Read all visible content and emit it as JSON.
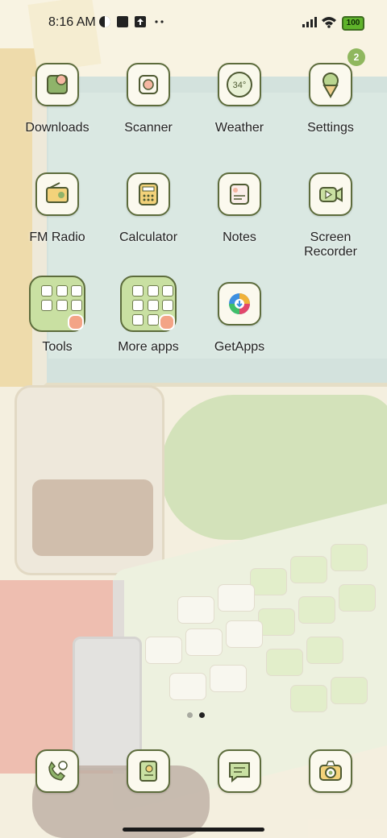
{
  "status_bar": {
    "time": "8:16 AM",
    "battery": "100"
  },
  "apps": [
    {
      "label": "Downloads",
      "icon": "download-icon",
      "badge": ""
    },
    {
      "label": "Scanner",
      "icon": "scan-icon",
      "badge": ""
    },
    {
      "label": "Weather",
      "icon": "weather-icon",
      "temp": "34°",
      "badge": ""
    },
    {
      "label": "Settings",
      "icon": "settings-icon",
      "badge": "2"
    },
    {
      "label": "FM Radio",
      "icon": "radio-icon"
    },
    {
      "label": "Calculator",
      "icon": "calculator-icon"
    },
    {
      "label": "Notes",
      "icon": "notes-icon"
    },
    {
      "label": "Screen Recorder",
      "label_line1": "Screen",
      "label_line2": "Recorder",
      "icon": "screen-recorder-icon"
    },
    {
      "label": "Tools",
      "icon": "folder-icon"
    },
    {
      "label": "More apps",
      "icon": "folder-icon"
    },
    {
      "label": "GetApps",
      "icon": "getapps-icon"
    }
  ],
  "dock": [
    {
      "icon": "phone-icon"
    },
    {
      "icon": "contacts-icon"
    },
    {
      "icon": "messages-icon"
    },
    {
      "icon": "camera-icon"
    }
  ],
  "pager": {
    "pages": 2,
    "current": 2
  }
}
